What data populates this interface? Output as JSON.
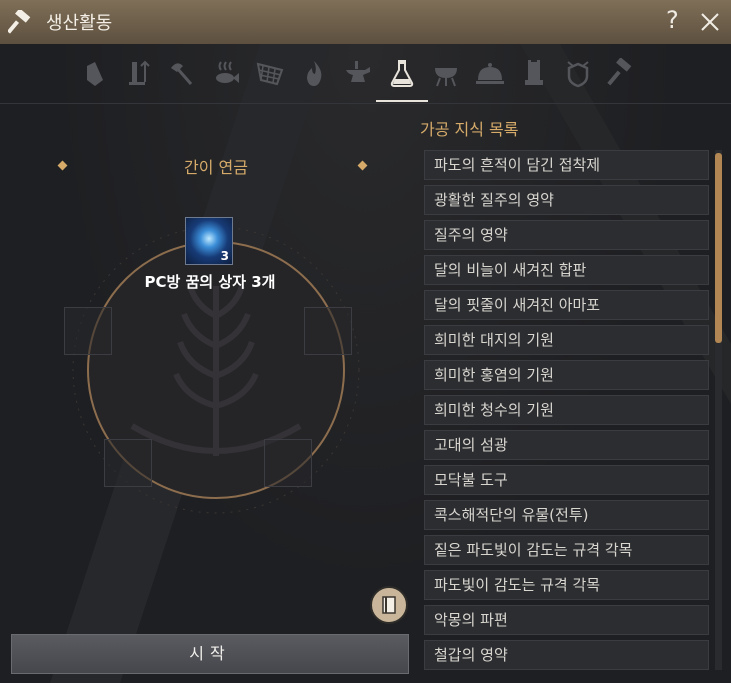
{
  "window": {
    "title": "생산활동"
  },
  "titlebar": {
    "help_label": "?"
  },
  "tabs": [
    {
      "icon": "gathering-bag-icon"
    },
    {
      "icon": "tool-check-icon"
    },
    {
      "icon": "axe-icon"
    },
    {
      "icon": "fish-steam-icon"
    },
    {
      "icon": "net-icon"
    },
    {
      "icon": "fire-icon"
    },
    {
      "icon": "anvil-icon"
    },
    {
      "icon": "flask-icon",
      "active": true
    },
    {
      "icon": "grill-icon"
    },
    {
      "icon": "cloche-icon"
    },
    {
      "icon": "alchemy-tower-icon"
    },
    {
      "icon": "crest-icon"
    },
    {
      "icon": "hammer-icon"
    }
  ],
  "recipe": {
    "title": "간이 연금",
    "item_name": "PC방 꿈의 상자 3개",
    "item_count": "3"
  },
  "start_button": {
    "label": "시작"
  },
  "knowledge_list": {
    "title": "가공 지식 목록",
    "items": [
      "파도의 흔적이 담긴 접착제",
      "광활한 질주의 영약",
      "질주의 영약",
      "달의 비늘이 새겨진 합판",
      "달의 핏줄이 새겨진 아마포",
      "희미한 대지의 기원",
      "희미한 홍염의 기원",
      "희미한 청수의 기원",
      "고대의 섬광",
      "모닥불 도구",
      "콕스해적단의 유물(전투)",
      "짙은 파도빛이 감도는 규격 각목",
      "파도빛이 감도는 규격 각목",
      "악몽의 파편",
      "철갑의 영약"
    ]
  },
  "colors": {
    "accent": "#d6ab6a",
    "titlebar": "#6e604c",
    "scroll_thumb": "#b28753"
  }
}
